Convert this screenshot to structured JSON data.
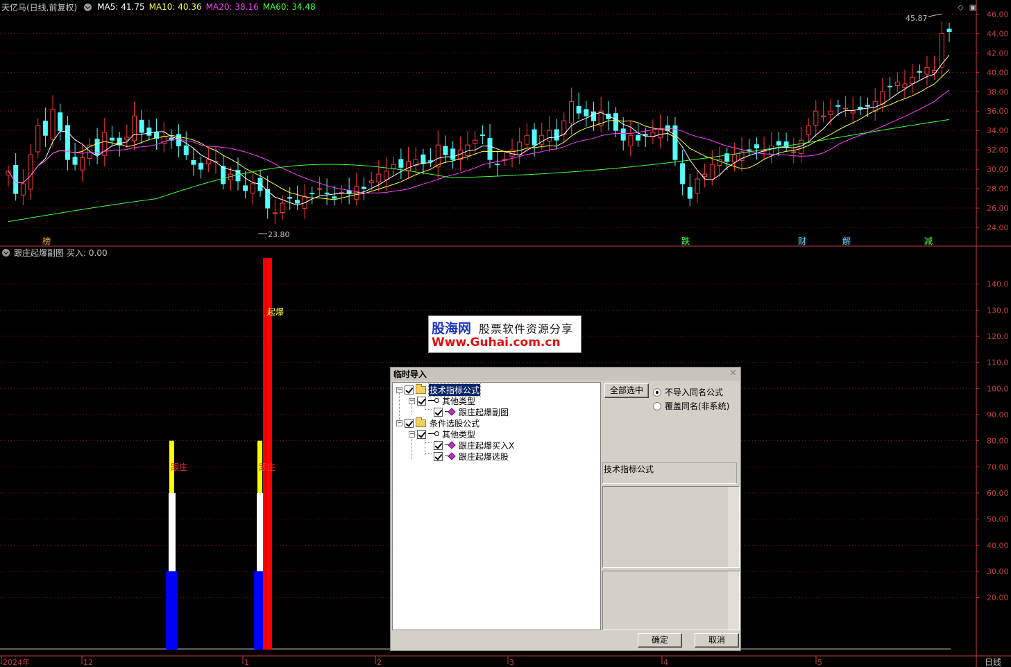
{
  "header": {
    "stock_title": "天亿马(日线,前复权)",
    "ma5": "MA5: 41.75",
    "ma10": "MA10: 40.36",
    "ma20": "MA20: 38.16",
    "ma60": "MA60: 34.48"
  },
  "colors": {
    "up": "#ff3c3c",
    "down": "#54ffff",
    "ma5": "#ffffff",
    "ma10": "#ffff40",
    "ma20": "#ff40ff",
    "ma60": "#40ff40",
    "axis": "#c84040",
    "grid": "#801818"
  },
  "price_axis": [
    "46.00",
    "44.00",
    "42.00",
    "40.00",
    "38.00",
    "36.00",
    "34.00",
    "32.00",
    "30.00",
    "28.00",
    "26.00",
    "24.00"
  ],
  "annotations": {
    "high_label": "45.87",
    "low_label": "23.80"
  },
  "event_markers": [
    "榜",
    "跌",
    "财",
    "解",
    "减"
  ],
  "sub": {
    "title": "跟庄起爆副图",
    "buy": "买入: 0.00",
    "axis": [
      "140.0",
      "130.0",
      "120.0",
      "110.0",
      "100.0",
      "90.00",
      "80.00",
      "70.00",
      "60.00",
      "50.00",
      "40.00",
      "30.00",
      "20.00"
    ],
    "label_follow": "跟庄",
    "label_burst": "起爆"
  },
  "time_axis": {
    "labels": [
      "2024年",
      "12",
      "1",
      "2",
      "3",
      "4",
      "5"
    ],
    "period": "日线"
  },
  "watermark": {
    "logo": "股海网",
    "slogan": "股票软件资源分享",
    "url": "Www.Guhai.com.cn"
  },
  "dialog": {
    "title": "临时导入",
    "tree": [
      {
        "label": "技术指标公式",
        "level": 0,
        "icon": "folder",
        "selected": true
      },
      {
        "label": "其他类型",
        "level": 1,
        "icon": "key"
      },
      {
        "label": "跟庄起爆副图",
        "level": 2,
        "icon": "item"
      },
      {
        "label": "条件选股公式",
        "level": 0,
        "icon": "folder"
      },
      {
        "label": "其他类型",
        "level": 1,
        "icon": "key"
      },
      {
        "label": "跟庄起爆买入X",
        "level": 2,
        "icon": "item"
      },
      {
        "label": "跟庄起爆选股",
        "level": 2,
        "icon": "item"
      }
    ],
    "select_all": "全部选中",
    "radio_no_import": "不导入同名公式",
    "radio_overwrite": "覆盖同名(非系统)",
    "info_title": "技术指标公式",
    "ok": "确定",
    "cancel": "取消"
  }
}
